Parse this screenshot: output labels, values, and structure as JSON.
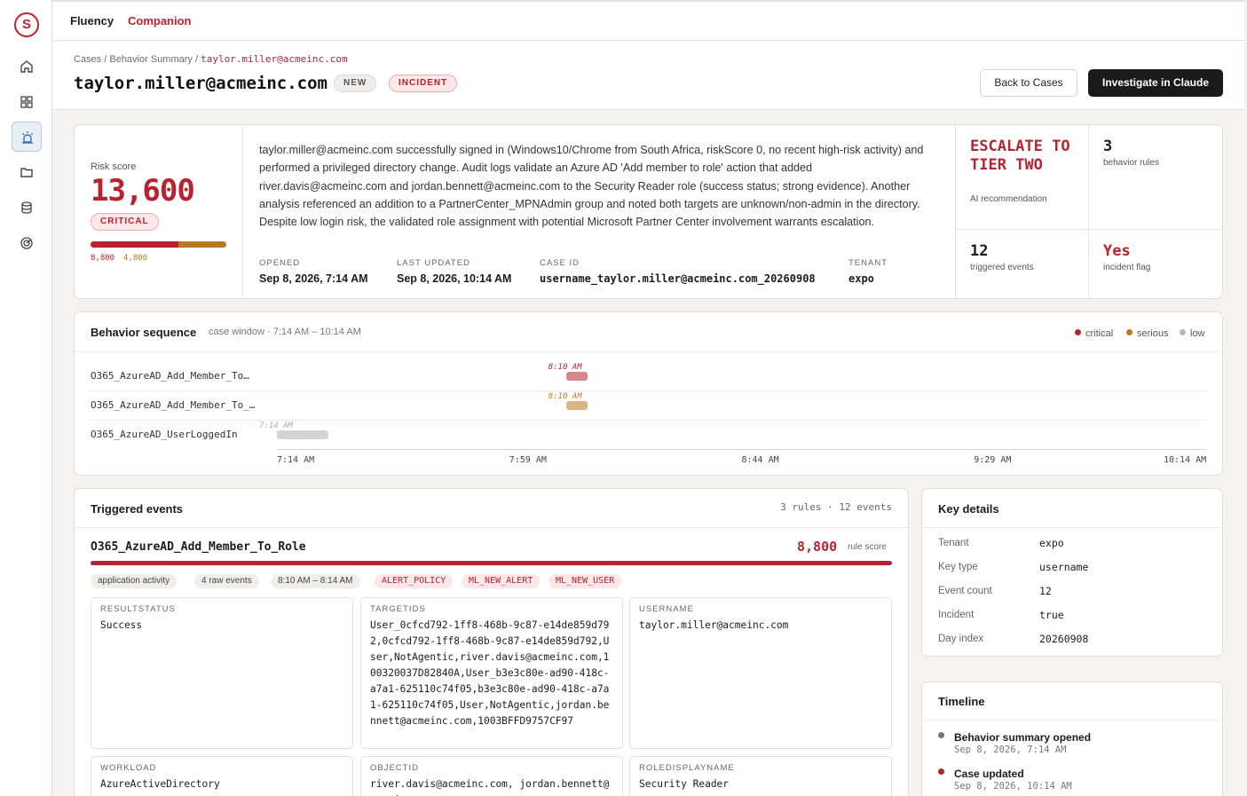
{
  "app": {
    "brand": "Fluency",
    "product": "Companion",
    "logo_letter": "S"
  },
  "breadcrumb": {
    "root": "Cases",
    "section": "Behavior Summary",
    "current": "taylor.miller@acmeinc.com"
  },
  "header": {
    "title": "taylor.miller@acmeinc.com",
    "badges": {
      "new": "NEW",
      "incident": "INCIDENT"
    },
    "buttons": {
      "back": "Back to Cases",
      "investigate": "Investigate in Claude"
    }
  },
  "summary": {
    "risk_label": "Risk score",
    "risk_score": "13,600",
    "severity": "CRITICAL",
    "risk_breakdown": [
      {
        "value": 8800,
        "label": "8,800"
      },
      {
        "value": 4800,
        "label": "4,800"
      }
    ],
    "description": "taylor.miller@acmeinc.com successfully signed in (Windows10/Chrome from South Africa, riskScore 0, no recent high-risk activity) and performed a privileged directory change. Audit logs validate an Azure AD 'Add member to role' action that added river.davis@acmeinc.com and jordan.bennett@acmeinc.com to the Security Reader role (success status; strong evidence). Another analysis referenced an addition to a PartnerCenter_MPNAdmin group and noted both targets are unknown/non-admin in the directory. Despite low login risk, the validated role assignment with potential Microsoft Partner Center involvement warrants escalation.",
    "meta": {
      "opened_label": "OPENED",
      "opened": "Sep 8, 2026, 7:14 AM",
      "updated_label": "LAST UPDATED",
      "updated": "Sep 8, 2026, 10:14 AM",
      "case_id_label": "CASE ID",
      "case_id": "username_taylor.miller@acmeinc.com_20260908",
      "tenant_label": "TENANT",
      "tenant": "expo"
    },
    "stats": {
      "recommendation": "ESCALATE TO TIER TWO",
      "recommendation_label": "AI recommendation",
      "rules": "3",
      "rules_label": "behavior rules",
      "events": "12",
      "events_label": "triggered events",
      "incident": "Yes",
      "incident_label": "incident flag"
    }
  },
  "sequence": {
    "title": "Behavior sequence",
    "window": "case window · 7:14 AM – 10:14 AM",
    "legend": {
      "critical": "critical",
      "serious": "serious",
      "low": "low"
    },
    "colors": {
      "critical": "#b8232f",
      "serious": "#b77a1e",
      "low": "#aaaaaa"
    },
    "axis_start_min": 434,
    "axis_end_min": 614,
    "ticks": [
      "7:14 AM",
      "7:59 AM",
      "8:44 AM",
      "9:29 AM",
      "10:14 AM"
    ],
    "lanes": [
      {
        "label": "O365_AzureAD_Add_Member_To…",
        "time": "8:10 AM",
        "start_min": 490,
        "end_min": 492,
        "severity": "critical"
      },
      {
        "label": "O365_AzureAD_Add_Member_To_…",
        "time": "8:10 AM",
        "start_min": 490,
        "end_min": 492,
        "severity": "serious"
      },
      {
        "label": "O365_AzureAD_UserLoggedIn",
        "time": "7:14 AM",
        "start_min": 434,
        "end_min": 444,
        "severity": "low"
      }
    ]
  },
  "events": {
    "title": "Triggered events",
    "count": "3 rules · 12 events",
    "rule": {
      "name": "O365_AzureAD_Add_Member_To_Role",
      "score": "8,800",
      "score_label": "rule score",
      "tags_gray": [
        "application activity",
        "4 raw events",
        "8:10 AM – 8:14 AM"
      ],
      "tags_red": [
        "ALERT_POLICY",
        "ML_NEW_ALERT",
        "ML_NEW_USER"
      ],
      "fields": [
        {
          "label": "RESULTSTATUS",
          "value": "Success"
        },
        {
          "label": "TARGETIDS",
          "value": "User_0cfcd792-1ff8-468b-9c87-e14de859d792,0cfcd792-1ff8-468b-9c87-e14de859d792,User,NotAgentic,river.davis@acmeinc.com,100320037D82840A,User_b3e3c80e-ad90-418c-a7a1-625110c74f05,b3e3c80e-ad90-418c-a7a1-625110c74f05,User,NotAgentic,jordan.bennett@acmeinc.com,1003BFFD9757CF97"
        },
        {
          "label": "USERNAME",
          "value": "taylor.miller@acmeinc.com"
        },
        {
          "label": "WORKLOAD",
          "value": "AzureActiveDirectory"
        },
        {
          "label": "OBJECTID",
          "value": "river.davis@acmeinc.com, jordan.bennett@acmeinc.com"
        },
        {
          "label": "ROLEDISPLAYNAME",
          "value": "Security Reader"
        }
      ]
    }
  },
  "key_details": {
    "title": "Key details",
    "rows": [
      {
        "k": "Tenant",
        "v": "expo"
      },
      {
        "k": "Key type",
        "v": "username"
      },
      {
        "k": "Event count",
        "v": "12"
      },
      {
        "k": "Incident",
        "v": "true"
      },
      {
        "k": "Day index",
        "v": "20260908"
      }
    ]
  },
  "timeline": {
    "title": "Timeline",
    "items": [
      {
        "text": "Behavior summary opened",
        "time": "Sep 8, 2026, 7:14 AM",
        "color": "#777777"
      },
      {
        "text": "Case updated",
        "time": "Sep 8, 2026, 10:14 AM",
        "color": "#b8232f"
      }
    ]
  }
}
